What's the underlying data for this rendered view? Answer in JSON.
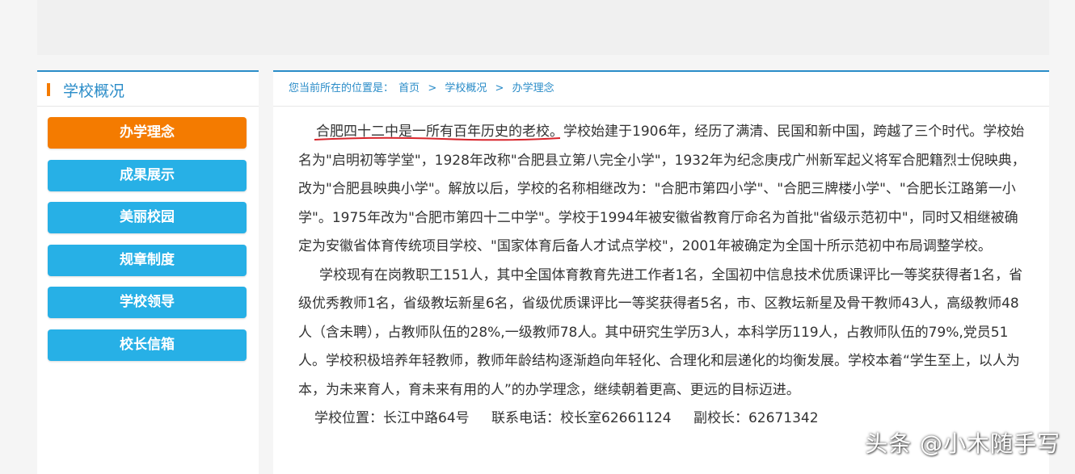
{
  "sidebar": {
    "title": "学校概况",
    "items": [
      {
        "label": "办学理念",
        "active": true
      },
      {
        "label": "成果展示"
      },
      {
        "label": "美丽校园"
      },
      {
        "label": "规章制度"
      },
      {
        "label": "学校领导"
      },
      {
        "label": "校长信箱"
      }
    ]
  },
  "breadcrumb": {
    "prefix": "您当前所在的位置是：",
    "items": [
      "首页",
      "学校概况",
      "办学理念"
    ],
    "separator": ">"
  },
  "article": {
    "p1_highlight": "合肥四十二中是一所有百年历史的老校",
    "p1_rest": "。学校始建于1906年，经历了满清、民国和新中国，跨越了三个时代。学校始名为\"启明初等学堂\"，1928年改称\"合肥县立第八完全小学\"，1932年为纪念庚戌广州新军起义将军合肥籍烈士倪映典，改为\"合肥县映典小学\"。解放以后，学校的名称相继改为：\"合肥市第四小学\"、\"合肥三牌楼小学\"、\"合肥长江路第一小学\"。1975年改为\"合肥市第四十二中学\"。学校于1994年被安徽省教育厅命名为首批\"省级示范初中\"，同时又相继被确定为安徽省体育传统项目学校、\"国家体育后备人才试点学校\"，2001年被确定为全国十所示范初中布局调整学校。",
    "p2": "学校现有在岗教职工151人，其中全国体育教育先进工作者1名，全国初中信息技术优质课评比一等奖获得者1名，省级优秀教师1名，省级教坛新星6名，省级优质课评比一等奖获得者5名，市、区教坛新星及骨干教师43人，高级教师48人（含未聘），占教师队伍的28%,一级教师78人。其中研究生学历3人，本科学历119人，占教师队伍的79%,党员51人。学校积极培养年轻教师，教师年龄结构逐渐趋向年轻化、合理化和层递化的均衡发展。学校本着“学生至上，以人为本，为未来育人，育未来有用的人”的办学理念，继续朝着更高、更远的目标迈进。",
    "contact": {
      "location": "学校位置：长江中路64号",
      "phone": "联系电话：校长室62661124",
      "vice": "副校长：62671342"
    }
  },
  "watermark": "头条 @小木随手写",
  "colors": {
    "accent": "#2a8cc8",
    "active": "#f47b00",
    "button": "#27b0e6",
    "underline": "#d8242b"
  }
}
